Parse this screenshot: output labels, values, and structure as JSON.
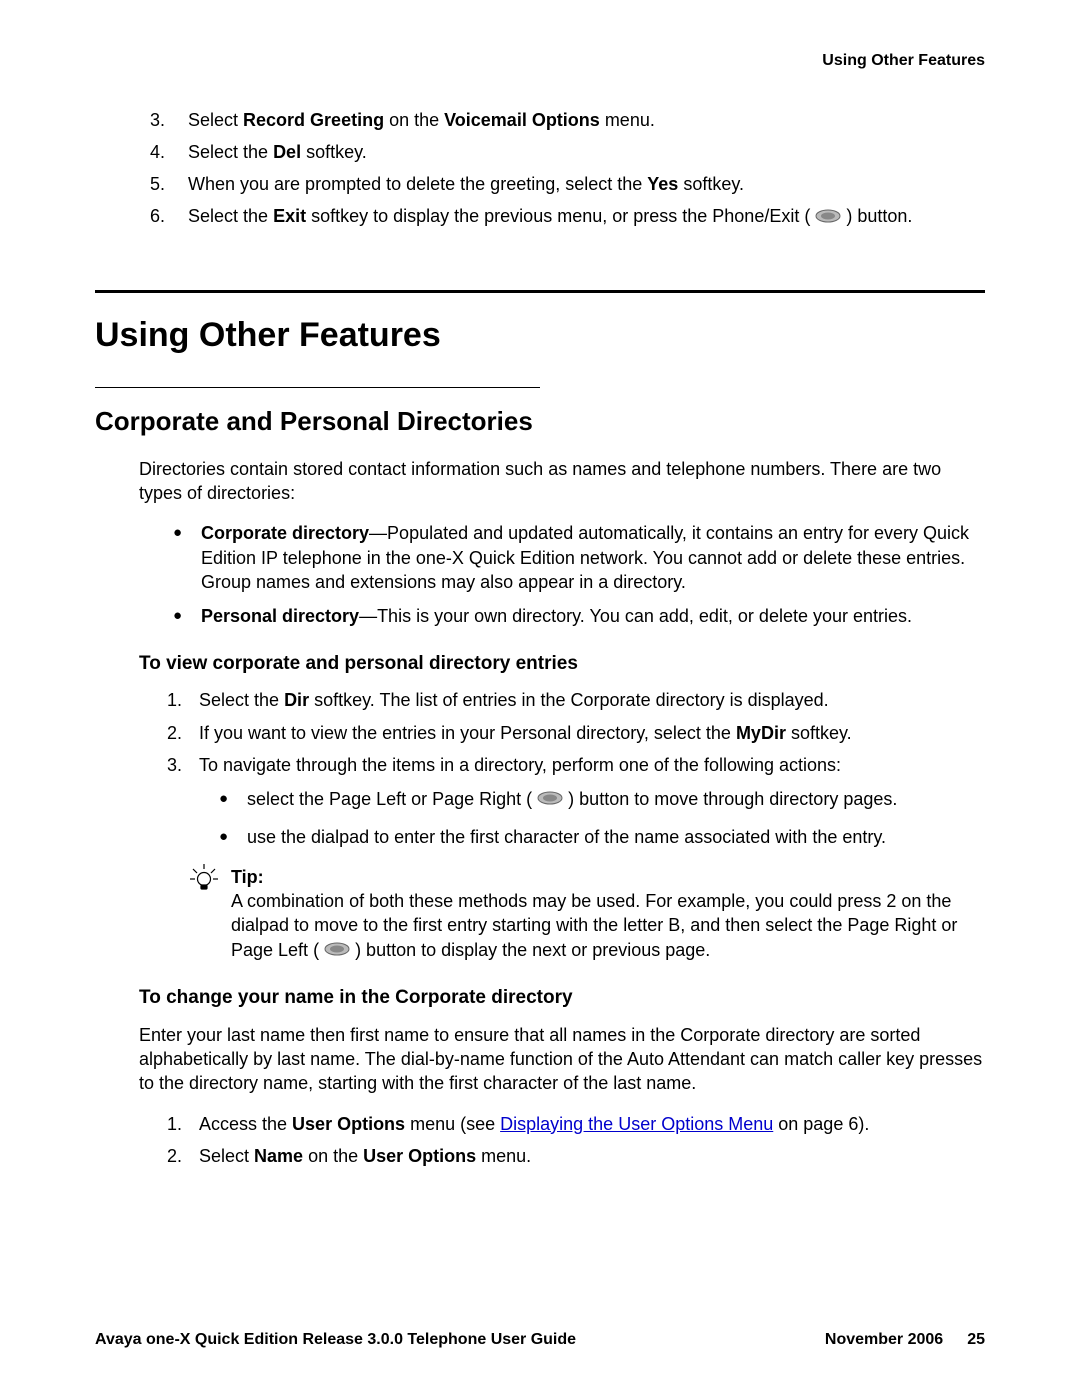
{
  "header": {
    "text": "Using Other Features"
  },
  "topList": {
    "item3": {
      "num": "3.",
      "pre": "Select ",
      "b1": "Record Greeting",
      "mid": " on the ",
      "b2": "Voicemail Options",
      "post": " menu."
    },
    "item4": {
      "num": "4.",
      "pre": "Select the ",
      "b1": "Del",
      "post": " softkey."
    },
    "item5": {
      "num": "5.",
      "pre": "When you are prompted to delete the greeting, select the ",
      "b1": "Yes",
      "post": " softkey."
    },
    "item6": {
      "num": "6.",
      "pre": "Select the ",
      "b1": "Exit",
      "post1": " softkey to display the previous menu, or press the Phone/Exit ( ",
      "post2": " ) button."
    }
  },
  "section1": {
    "title": "Using Other Features"
  },
  "section2": {
    "title": "Corporate and Personal Directories"
  },
  "intro": "Directories contain stored contact information such as names and telephone numbers. There are two types of directories:",
  "bullets": {
    "b1": {
      "bold": "Corporate directory",
      "text": "—Populated and updated automatically, it contains an entry for every Quick Edition IP telephone in the one-X Quick Edition network. You cannot add or delete these entries. Group names and extensions may also appear in a directory."
    },
    "b2": {
      "bold": "Personal directory",
      "text": "—This is your own directory. You can add, edit, or delete your entries."
    }
  },
  "h3a": "To view corporate and personal directory entries",
  "list1": {
    "i1": {
      "num": "1.",
      "pre": "Select the ",
      "b": "Dir",
      "post": " softkey. The list of entries in the Corporate directory is displayed."
    },
    "i2": {
      "num": "2.",
      "pre": "If you want to view the entries in your Personal directory, select the ",
      "b": "MyDir",
      "post": " softkey."
    },
    "i3": {
      "num": "3.",
      "text": "To navigate through the items in a directory, perform one of the following actions:"
    }
  },
  "subBullets": {
    "s1a": "select the Page Left or Page Right ( ",
    "s1b": " ) button to move through directory pages.",
    "s2": "use the dialpad to enter the first character of the name associated with the entry."
  },
  "tip": {
    "label": "Tip:",
    "textA": "A combination of both these methods may be used. For example, you could press 2 on the dialpad to move to the first entry starting with the letter B, and then select the Page Right or Page Left ( ",
    "textB": " ) button to display the next or previous page."
  },
  "h3b": "To change your name in the Corporate directory",
  "para2": "Enter your last name then first name to ensure that all names in the Corporate directory are sorted alphabetically by last name. The dial-by-name function of the Auto Attendant can match caller key presses to the directory name, starting with the first character of the last name.",
  "list2": {
    "i1": {
      "num": "1.",
      "pre": "Access the ",
      "b": "User Options",
      "mid": " menu (see ",
      "link": "Displaying the User Options Menu",
      "post": " on page 6)."
    },
    "i2": {
      "num": "2.",
      "pre": "Select ",
      "b1": "Name",
      "mid": " on the ",
      "b2": "User Options",
      "post": " menu."
    }
  },
  "footer": {
    "left": "Avaya one-X Quick Edition Release 3.0.0 Telephone User Guide",
    "date": "November 2006",
    "page": "25"
  }
}
